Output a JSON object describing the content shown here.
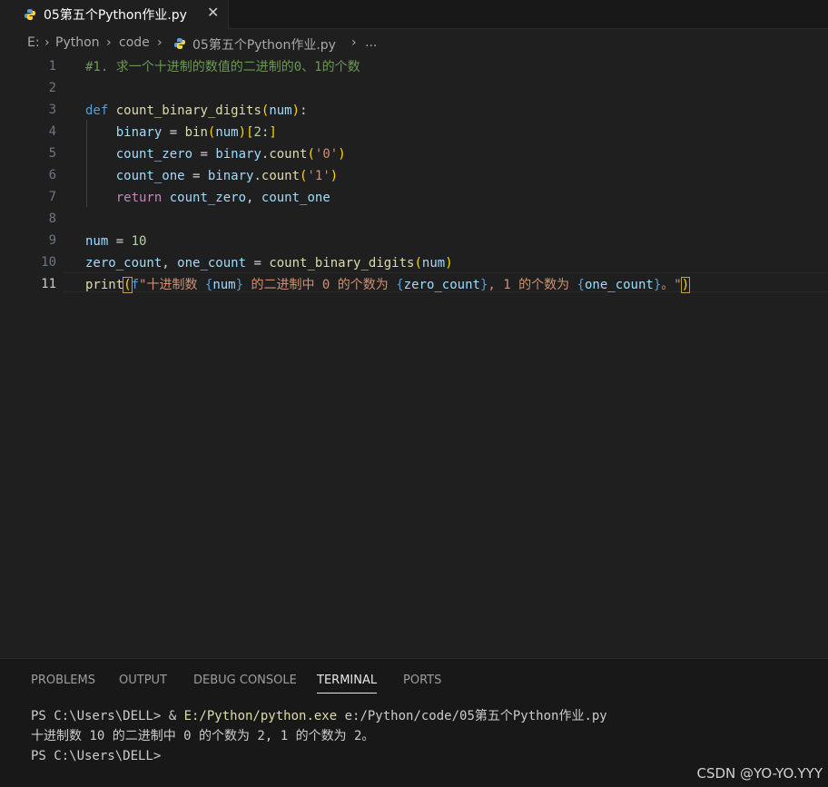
{
  "tab": {
    "filename": "05第五个Python作业.py",
    "close": "✕"
  },
  "breadcrumb": {
    "drive": "E:",
    "sep": "›",
    "folder1": "Python",
    "folder2": "code",
    "file": "05第五个Python作业.py",
    "more": "..."
  },
  "editor": {
    "line_numbers": [
      "1",
      "2",
      "3",
      "4",
      "5",
      "6",
      "7",
      "8",
      "9",
      "10",
      "11"
    ],
    "active_line": 11,
    "tokens": {
      "l1_comment": "#1. 求一个十进制的数值的二进制的0、1的个数",
      "l3_def": "def",
      "l3_fn": "count_binary_digits",
      "l3_paren_open": "(",
      "l3_param": "num",
      "l3_paren_close": ")",
      "l3_colon": ":",
      "l4_var": "binary",
      "l4_eq": " = ",
      "l4_fn": "bin",
      "l4_po": "(",
      "l4_arg": "num",
      "l4_pc": ")",
      "l4_bo": "[",
      "l4_num": "2",
      "l4_colon": ":",
      "l4_bc": "]",
      "l5_var": "count_zero",
      "l5_eq": " = ",
      "l5_obj": "binary",
      "l5_dot": ".",
      "l5_fn": "count",
      "l5_po": "(",
      "l5_str": "'0'",
      "l5_pc": ")",
      "l6_var": "count_one",
      "l6_eq": " = ",
      "l6_obj": "binary",
      "l6_dot": ".",
      "l6_fn": "count",
      "l6_po": "(",
      "l6_str": "'1'",
      "l6_pc": ")",
      "l7_ret": "return",
      "l7_v1": "count_zero",
      "l7_comma": ", ",
      "l7_v2": "count_one",
      "l9_var": "num",
      "l9_eq": " = ",
      "l9_num": "10",
      "l10_v1": "zero_count",
      "l10_comma": ", ",
      "l10_v2": "one_count",
      "l10_eq": " = ",
      "l10_fn": "count_binary_digits",
      "l10_po": "(",
      "l10_arg": "num",
      "l10_pc": ")",
      "l11_fn": "print",
      "l11_po": "(",
      "l11_f": "f",
      "l11_s1": "\"十进制数 ",
      "l11_b1o": "{",
      "l11_v1": "num",
      "l11_b1c": "}",
      "l11_s2": " 的二进制中 0 的个数为 ",
      "l11_b2o": "{",
      "l11_v2": "zero_count",
      "l11_b2c": "}",
      "l11_s3": ", 1 的个数为 ",
      "l11_b3o": "{",
      "l11_v3": "one_count",
      "l11_b3c": "}",
      "l11_s4": "。\"",
      "l11_pc": ")"
    }
  },
  "panel": {
    "tabs": [
      "PROBLEMS",
      "OUTPUT",
      "DEBUG CONSOLE",
      "TERMINAL",
      "PORTS"
    ],
    "active_tab": "TERMINAL",
    "terminal": {
      "prompt1": "PS C:\\Users\\DELL> ",
      "amp": "& ",
      "exe": "E:/Python/python.exe",
      "script": " e:/Python/code/05第五个Python作业.py",
      "output": "十进制数 10 的二进制中 0 的个数为 2, 1 的个数为 2。",
      "prompt2": "PS C:\\Users\\DELL> "
    }
  },
  "watermark": "CSDN @YO-YO.YYY",
  "colors": {
    "background": "#1f1f1f",
    "keyword": "#569cd6",
    "function": "#dcdcaa",
    "variable": "#9cdcfe",
    "string": "#ce9178",
    "number": "#b5cea8",
    "comment": "#6a9955"
  }
}
